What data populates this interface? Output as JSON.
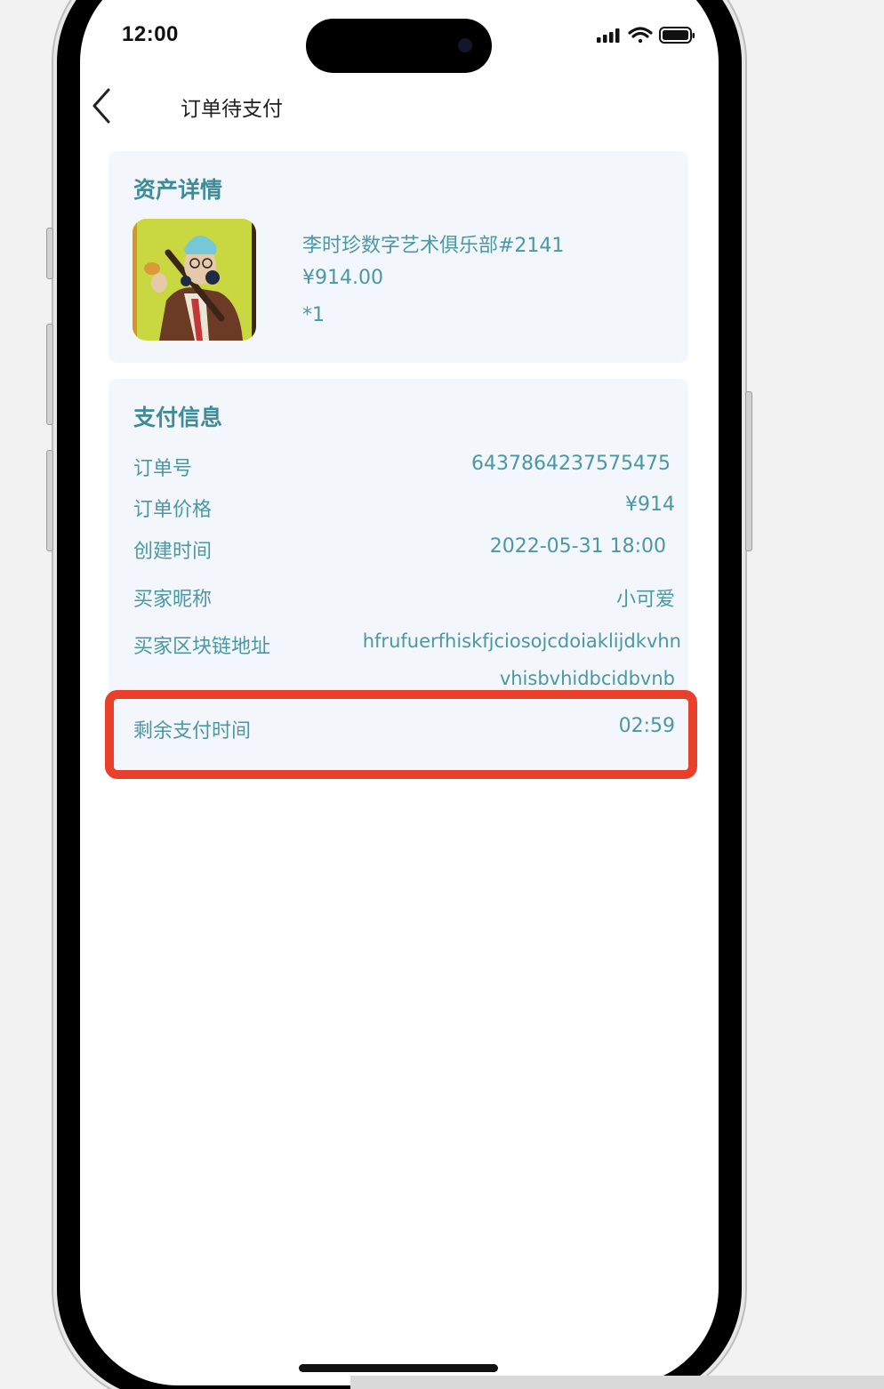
{
  "status_bar": {
    "time": "12:00",
    "icons": [
      "signal-icon",
      "wifi-icon",
      "battery-icon"
    ]
  },
  "nav": {
    "back_icon": "chevron-left-icon",
    "title": "订单待支付"
  },
  "asset_card": {
    "title": "资产详情",
    "image_icon": "nft-artwork-thumbnail",
    "name": "李时珍数字艺术俱乐部#2141",
    "price": "¥914.00",
    "quantity": "*1"
  },
  "payment_card": {
    "title": "支付信息",
    "rows": [
      {
        "label": "订单号",
        "value": "6437864237575475"
      },
      {
        "label": "订单价格",
        "value": "¥914"
      },
      {
        "label": "创建时间",
        "value": "2022-05-31 18:00"
      },
      {
        "label": "买家昵称",
        "value": "小可爱"
      },
      {
        "label": "买家区块链地址",
        "value": "hfrufuerfhiskfjciosojcdoiaklijdkvhn",
        "value_line2": "vhisbvhidbcidbvnb"
      }
    ],
    "countdown": {
      "label": "剩余支付时间",
      "value": "02:59"
    }
  },
  "colors": {
    "accent_teal": "#4a98a4",
    "card_bg": "#f3f6fa",
    "highlight_red": "#e8402a"
  }
}
